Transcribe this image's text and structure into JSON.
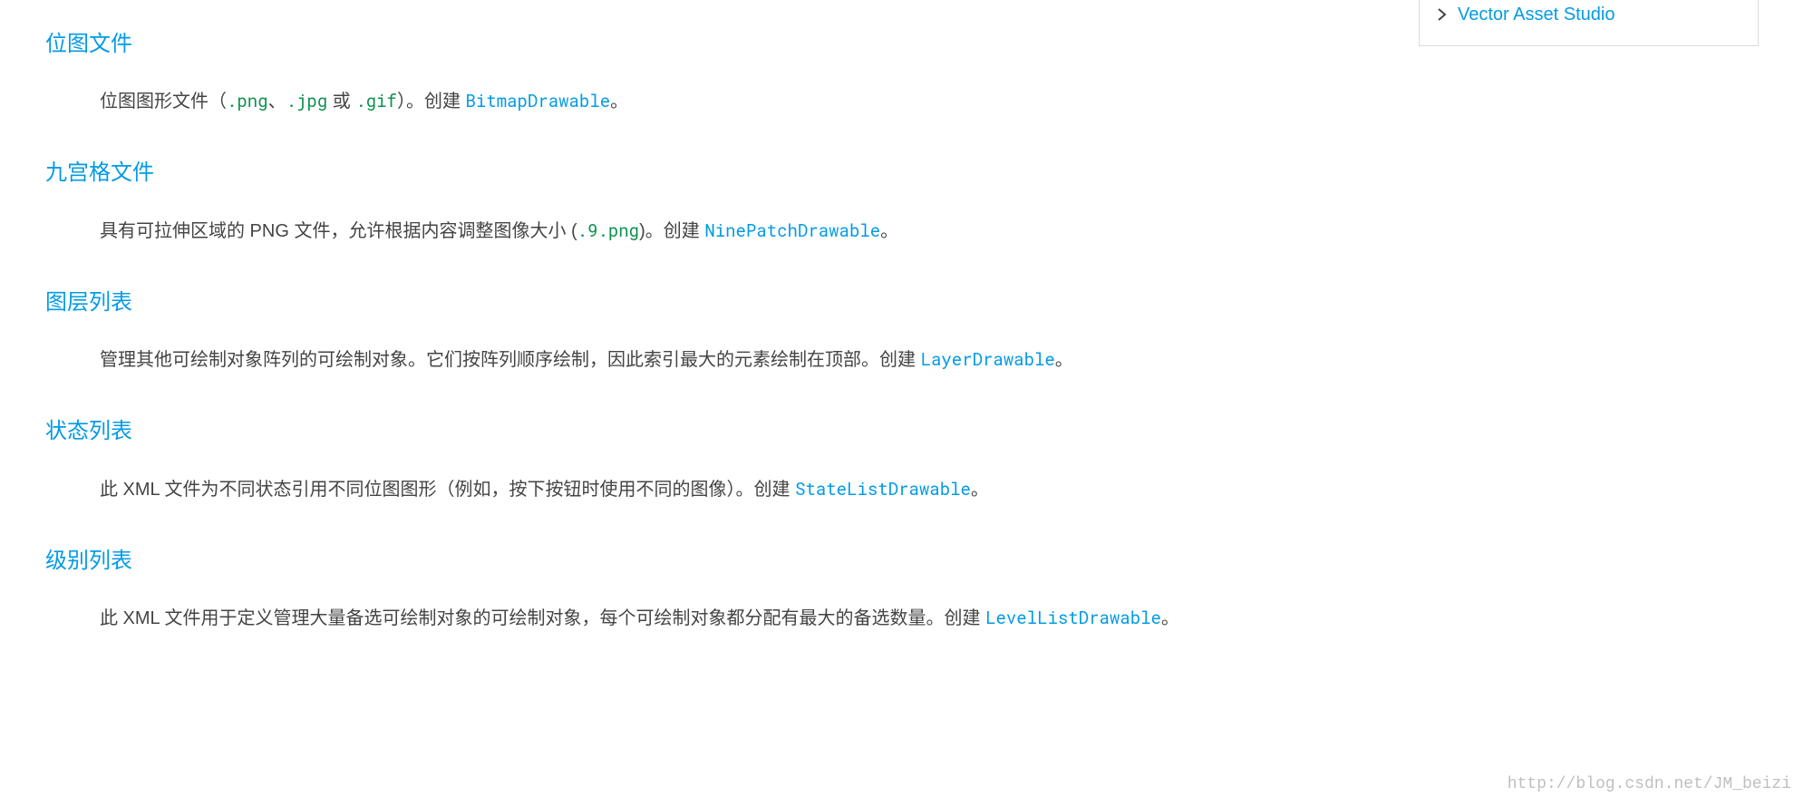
{
  "sidebar": {
    "item_label": "Vector Asset Studio"
  },
  "sections": [
    {
      "title": "位图文件",
      "desc_prefix": "位图图形文件（",
      "codes": [
        ".png",
        ".jpg",
        ".gif"
      ],
      "code_sep1": "、",
      "code_sep2": " 或 ",
      "desc_after_codes": "）。创建 ",
      "api": "BitmapDrawable",
      "desc_suffix": "。"
    },
    {
      "title": "九宫格文件",
      "desc_prefix": "具有可拉伸区域的 PNG 文件，允许根据内容调整图像大小 (",
      "codes": [
        ".9.png"
      ],
      "desc_after_codes": ")。创建 ",
      "api": "NinePatchDrawable",
      "desc_suffix": "。"
    },
    {
      "title": "图层列表",
      "desc_prefix": "管理其他可绘制对象阵列的可绘制对象。它们按阵列顺序绘制，因此索引最大的元素绘制在顶部。创建 ",
      "api": "LayerDrawable",
      "desc_suffix": "。"
    },
    {
      "title": "状态列表",
      "desc_prefix": "此 XML 文件为不同状态引用不同位图图形（例如，按下按钮时使用不同的图像）。创建 ",
      "api": "StateListDrawable",
      "desc_suffix": "。"
    },
    {
      "title": "级别列表",
      "desc_prefix": "此 XML 文件用于定义管理大量备选可绘制对象的可绘制对象，每个可绘制对象都分配有最大的备选数量。创建 ",
      "api": "LevelListDrawable",
      "desc_suffix": "。"
    }
  ],
  "watermark": "http://blog.csdn.net/JM_beizi"
}
